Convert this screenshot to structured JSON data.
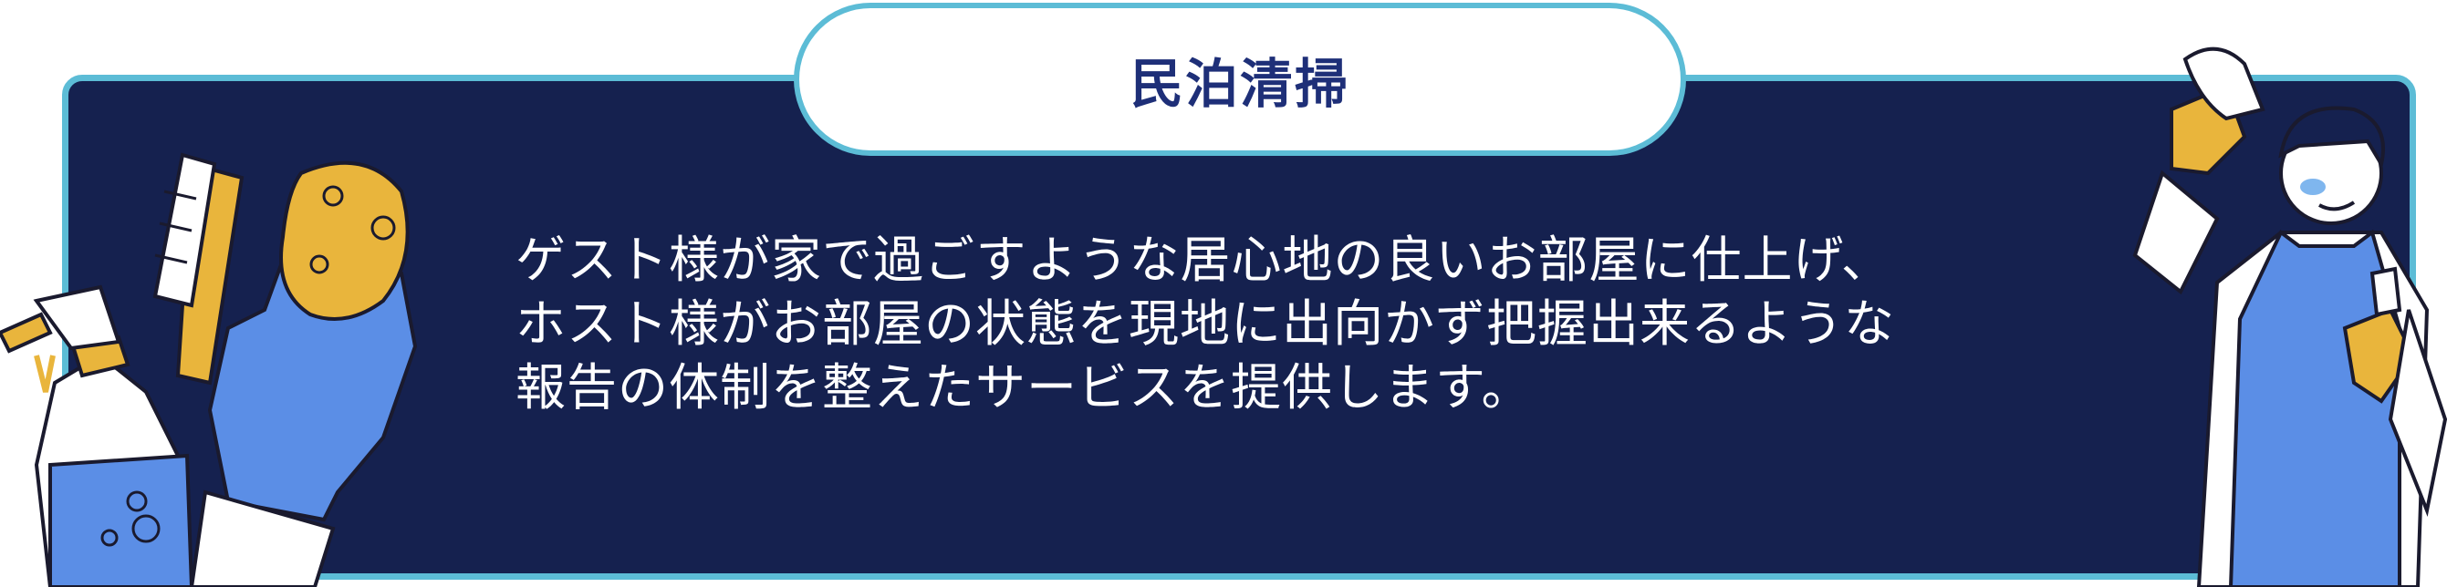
{
  "title": "民泊清掃",
  "description": "ゲスト様が家で過ごすような居心地の良いお部屋に仕上げ、ホスト様がお部屋の状態を現地に出向かず把握出来るような報告の体制を整えたサービスを提供します。",
  "colors": {
    "panel_background": "#15214f",
    "border_accent": "#5cbcd6",
    "title_text": "#1e2f78",
    "glove_blue": "#5b8ee6",
    "sponge_yellow": "#e9b53c"
  },
  "icons": [
    "spray-bottle-icon",
    "scrub-brush-icon",
    "sponge-icon",
    "cleaning-glove-icon",
    "cleaner-person-icon"
  ]
}
